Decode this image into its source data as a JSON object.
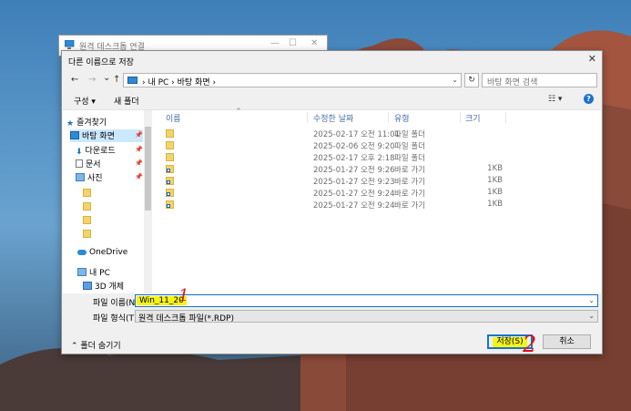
{
  "back_window": {
    "title": "원격 데스크톱 연결",
    "controls": [
      "—",
      "☐",
      "✕"
    ]
  },
  "dialog": {
    "title": "다른 이름으로 저장",
    "close": "✕",
    "nav": {
      "back": "←",
      "forward": "→",
      "recent": "⌄",
      "up": "↑"
    },
    "address": {
      "text": "› 내 PC › 바탕 화면 ›",
      "dropdown": "⌄",
      "refresh": "↻"
    },
    "search_placeholder": "바탕 화면 검색",
    "toolbar": {
      "organize": "구성 ▾",
      "new_folder": "새 폴더",
      "view": "☷ ▾",
      "help": "?"
    },
    "nav_pane": {
      "quick_access": "즐겨찾기",
      "desktop": "바탕 화면",
      "downloads": "다운로드",
      "documents": "문서",
      "pictures": "사진",
      "onedrive": "OneDrive",
      "this_pc": "내 PC",
      "objects3d": "3D 개체",
      "pin": "📌"
    },
    "columns": {
      "name": "이름",
      "modified": "수정한 날짜",
      "type": "유형",
      "size": "크기",
      "sort": "^"
    },
    "files": [
      {
        "kind": "folder",
        "date": "2025-02-17 오전 11:01",
        "type": "파일 폴더",
        "size": ""
      },
      {
        "kind": "folder",
        "date": "2025-02-06 오전 9:20",
        "type": "파일 폴더",
        "size": ""
      },
      {
        "kind": "folder",
        "date": "2025-02-17 오후 2:18",
        "type": "파일 폴더",
        "size": ""
      },
      {
        "kind": "shortcut",
        "date": "2025-01-27 오전 9:26",
        "type": "바로 가기",
        "size": "1KB"
      },
      {
        "kind": "shortcut",
        "date": "2025-01-27 오전 9:23",
        "type": "바로 가기",
        "size": "1KB"
      },
      {
        "kind": "shortcut",
        "date": "2025-01-27 오전 9:24",
        "type": "바로 가기",
        "size": "1KB"
      },
      {
        "kind": "shortcut",
        "date": "2025-01-27 오전 9:24",
        "type": "바로 가기",
        "size": "1KB"
      }
    ],
    "filename_label": "파일 이름(N):",
    "filename_value": "Win_11_20",
    "filetype_label": "파일 형식(T):",
    "filetype_value": "원격 데스크톱 파일(*.RDP)",
    "hide_folders": "⌃ 폴더 숨기기",
    "save_button": "저장(S)",
    "cancel_button": "취소"
  },
  "annotations": {
    "one": "1",
    "two": "2"
  },
  "colors": {
    "accent": "#1a73c9",
    "highlight": "#f4f415",
    "annotation": "#e01010"
  }
}
